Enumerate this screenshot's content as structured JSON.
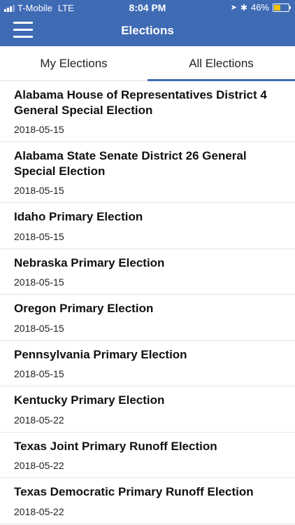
{
  "status": {
    "carrier": "T-Mobile",
    "network": "LTE",
    "time": "8:04 PM",
    "battery": "46%",
    "battery_level": 0.46,
    "signal_bars": 3
  },
  "nav": {
    "title": "Elections",
    "menu_icon": "hamburger-menu-icon",
    "color": "#3f6bb5"
  },
  "tabs": [
    {
      "label": "My Elections",
      "selected": false
    },
    {
      "label": "All Elections",
      "selected": true
    }
  ],
  "elections": [
    {
      "name": "Alabama House of Representatives District 4 General Special Election",
      "date": "2018-05-15"
    },
    {
      "name": "Alabama State Senate District 26 General Special Election",
      "date": "2018-05-15"
    },
    {
      "name": "Idaho Primary Election",
      "date": "2018-05-15"
    },
    {
      "name": "Nebraska Primary Election",
      "date": "2018-05-15"
    },
    {
      "name": "Oregon Primary Election",
      "date": "2018-05-15"
    },
    {
      "name": "Pennsylvania Primary Election",
      "date": "2018-05-15"
    },
    {
      "name": "Kentucky Primary Election",
      "date": "2018-05-22"
    },
    {
      "name": "Texas Joint Primary Runoff Election",
      "date": "2018-05-22"
    },
    {
      "name": "Texas Democratic Primary Runoff Election",
      "date": "2018-05-22"
    }
  ]
}
